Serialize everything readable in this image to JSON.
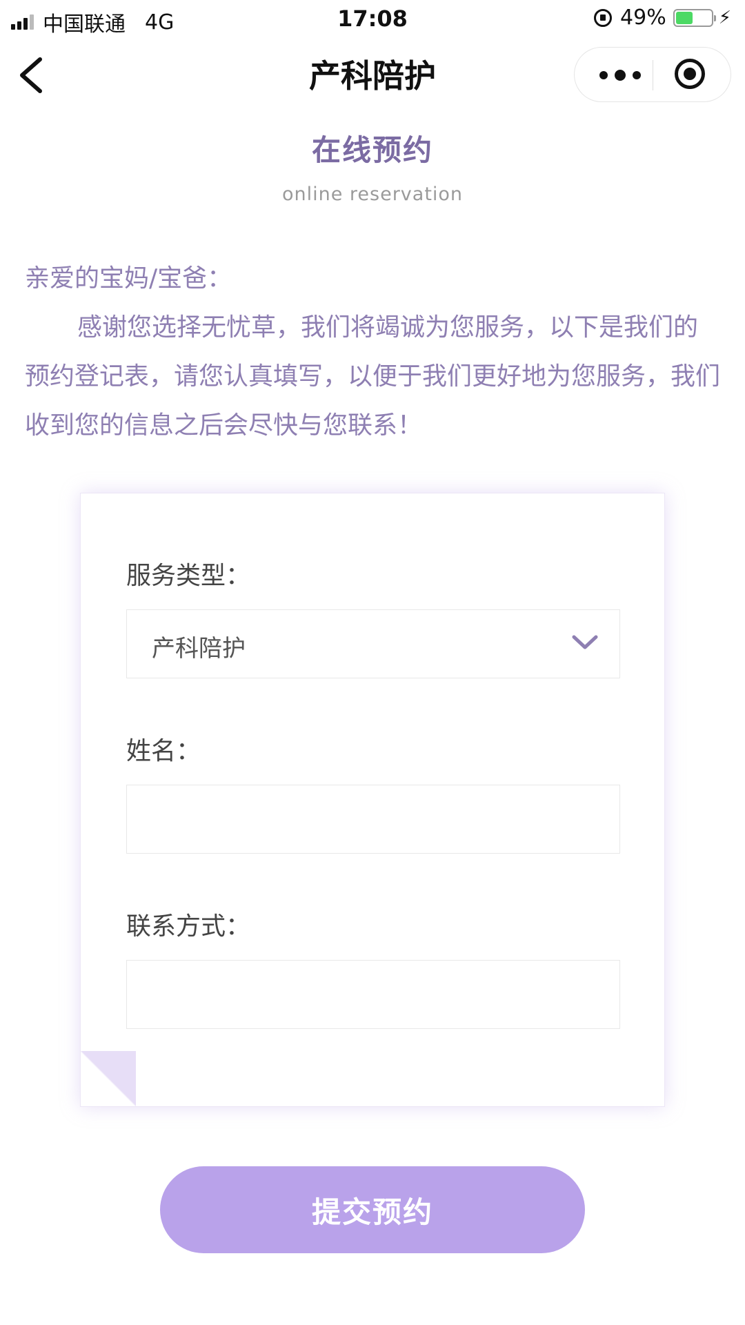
{
  "status_bar": {
    "carrier": "中国联通",
    "network": "4G",
    "time": "17:08",
    "battery": "49%",
    "battery_color": "#4cd964"
  },
  "nav": {
    "back_icon": "chevron-left-icon",
    "title": "产科陪护",
    "more_icon": "more-dots-icon",
    "close_icon": "target-close-icon"
  },
  "heading": {
    "title": "在线预约",
    "subtitle": "online reservation"
  },
  "intro": {
    "greeting": "亲爱的宝妈/宝爸：",
    "body": "感谢您选择无忧草，我们将竭诚为您服务，以下是我们的预约登记表，请您认真填写，以便于我们更好地为您服务，我们收到您的信息之后会尽快与您联系！"
  },
  "form": {
    "service_type_label": "服务类型：",
    "service_type_value": "产科陪护",
    "name_label": "姓名：",
    "name_value": "",
    "contact_label": "联系方式：",
    "contact_value": ""
  },
  "submit": {
    "label": "提交预约",
    "color": "#b9a2ea"
  },
  "theme": {
    "accent_text": "#7b6ba3",
    "intro_text": "#8e7fb2"
  }
}
